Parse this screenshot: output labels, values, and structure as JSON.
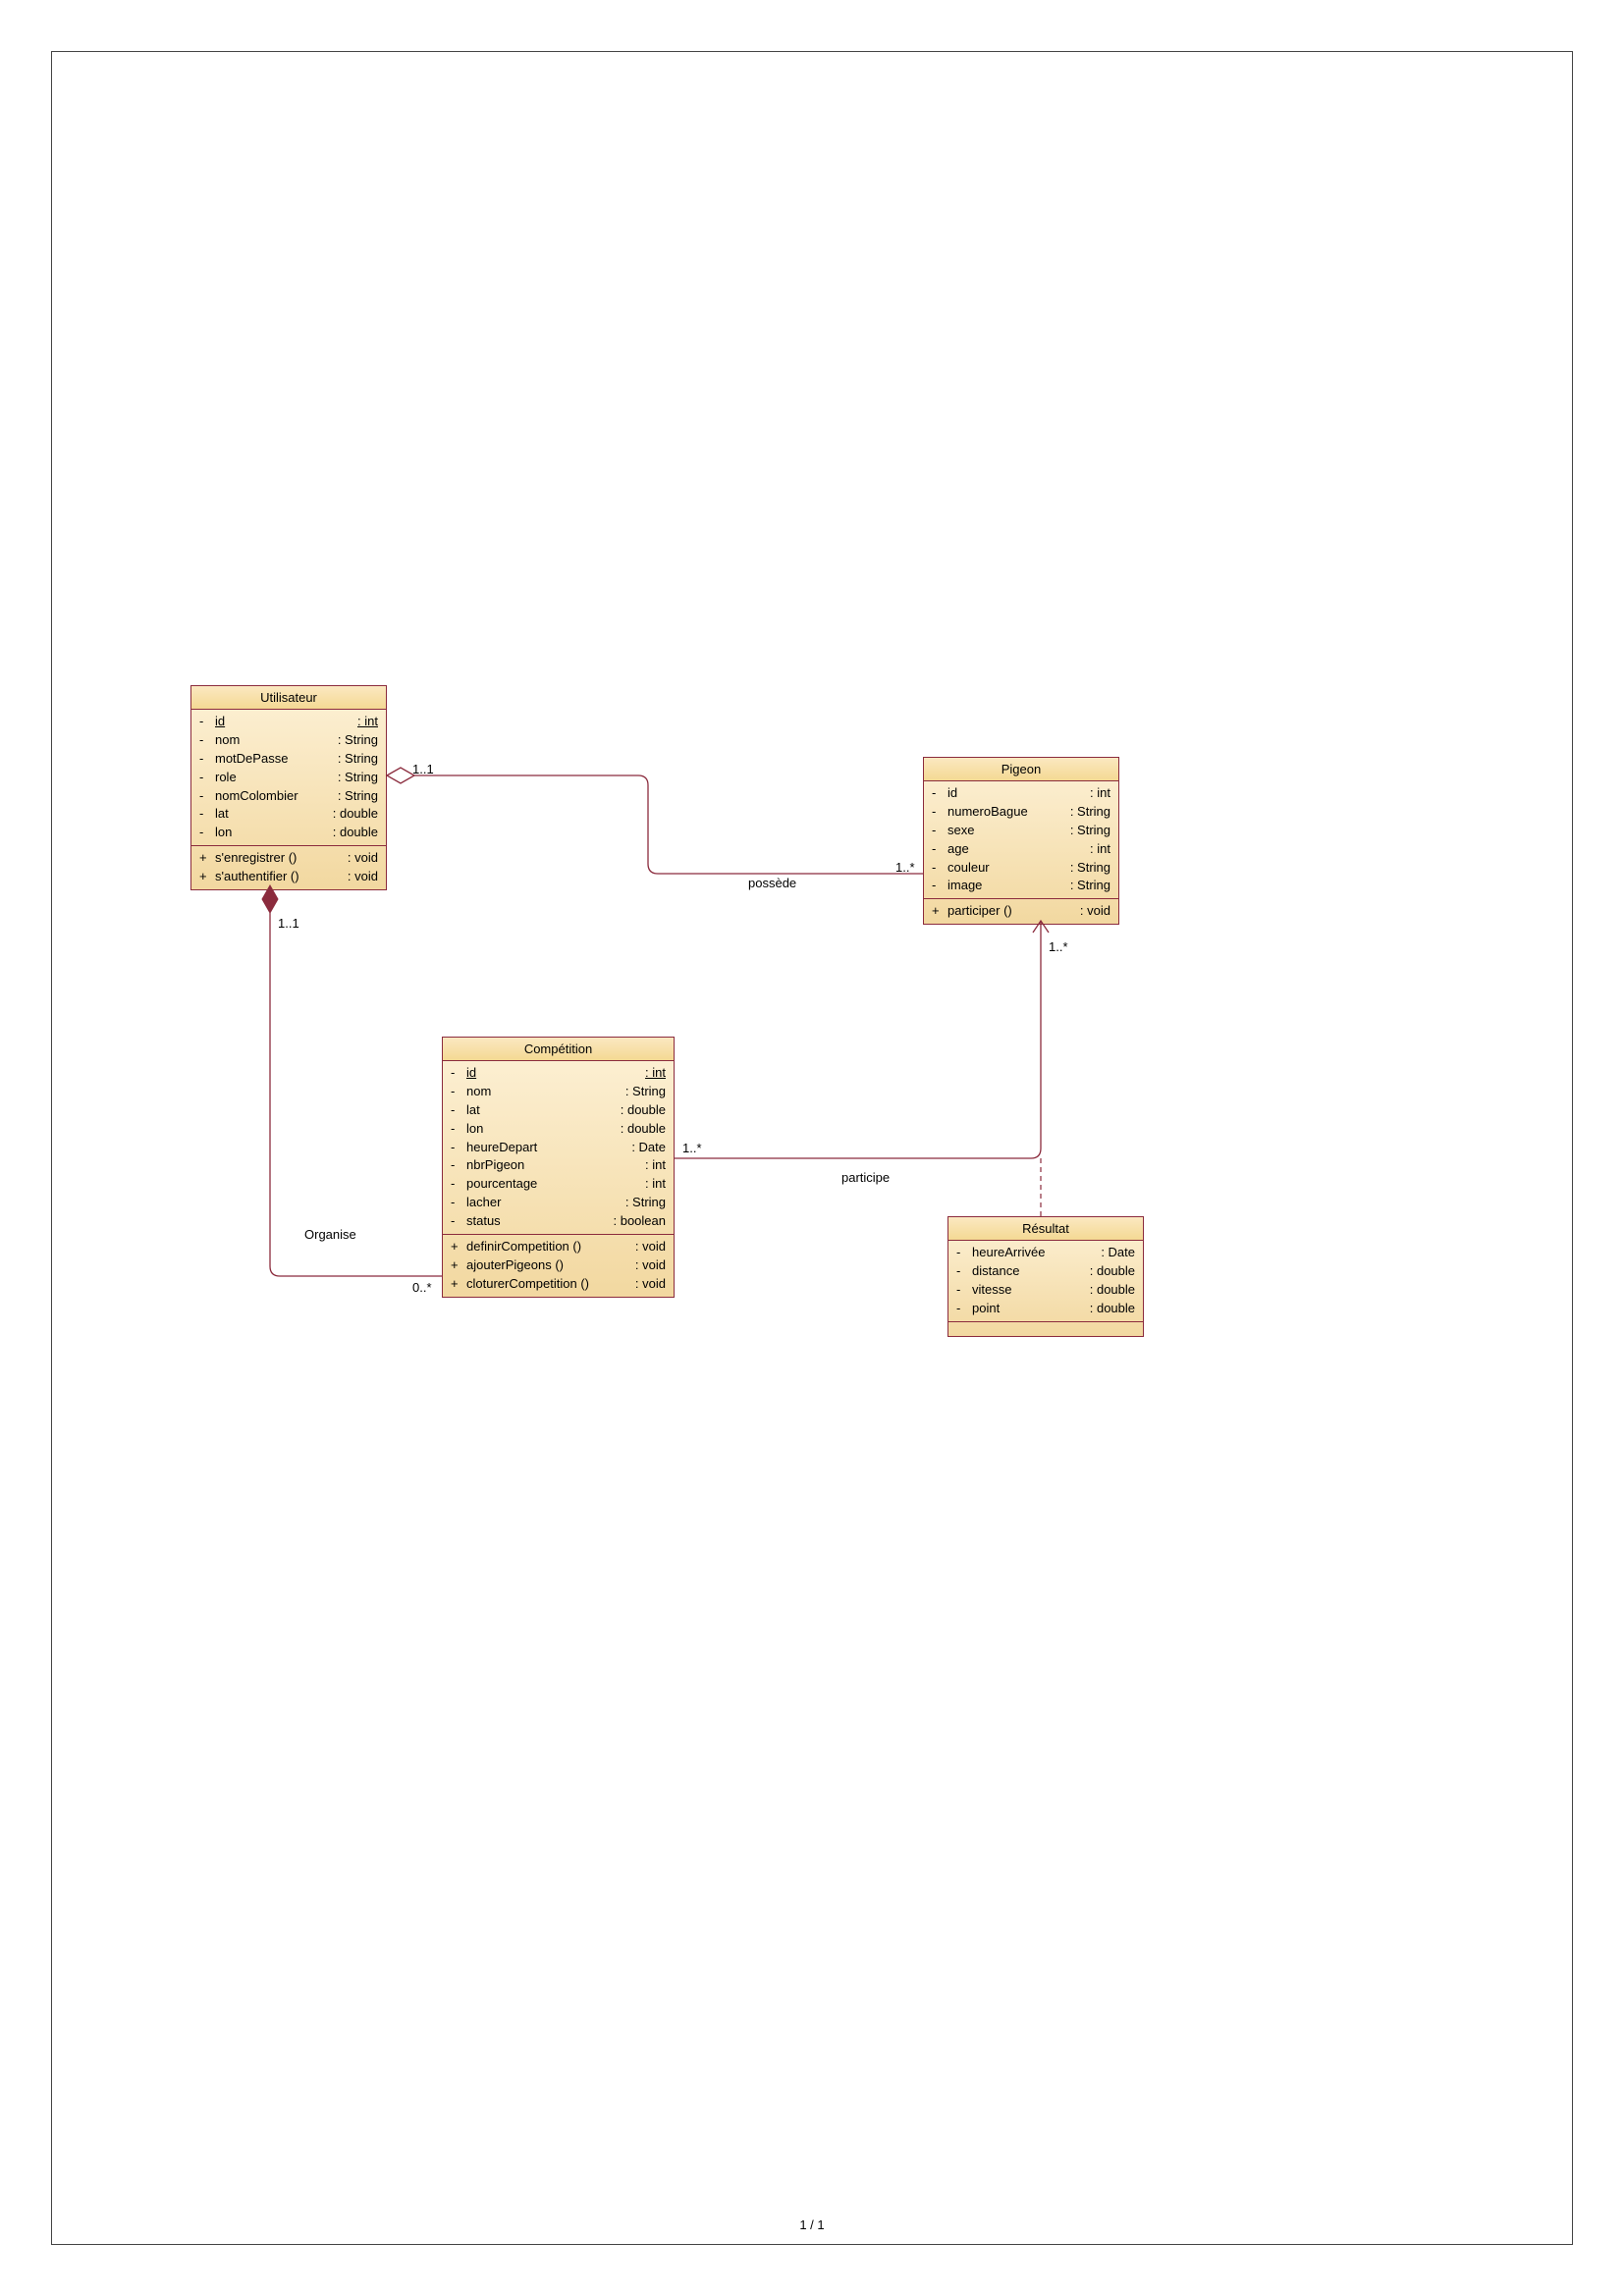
{
  "page_number": "1 / 1",
  "classes": {
    "utilisateur": {
      "title": "Utilisateur",
      "attrs": [
        {
          "vis": "-",
          "name": "id",
          "type": ": int",
          "underline": true
        },
        {
          "vis": "-",
          "name": "nom",
          "type": ": String"
        },
        {
          "vis": "-",
          "name": "motDePasse",
          "type": ": String"
        },
        {
          "vis": "-",
          "name": "role",
          "type": ": String"
        },
        {
          "vis": "-",
          "name": "nomColombier",
          "type": ": String"
        },
        {
          "vis": "-",
          "name": "lat",
          "type": ": double"
        },
        {
          "vis": "-",
          "name": "lon",
          "type": ": double"
        }
      ],
      "ops": [
        {
          "vis": "+",
          "name": "s'enregistrer ()",
          "type": ": void"
        },
        {
          "vis": "+",
          "name": "s'authentifier ()",
          "type": ": void"
        }
      ]
    },
    "pigeon": {
      "title": "Pigeon",
      "attrs": [
        {
          "vis": "-",
          "name": "id",
          "type": ": int"
        },
        {
          "vis": "-",
          "name": "numeroBague",
          "type": ": String"
        },
        {
          "vis": "-",
          "name": "sexe",
          "type": ": String"
        },
        {
          "vis": "-",
          "name": "age",
          "type": ": int"
        },
        {
          "vis": "-",
          "name": "couleur",
          "type": ": String"
        },
        {
          "vis": "-",
          "name": "image",
          "type": ": String"
        }
      ],
      "ops": [
        {
          "vis": "+",
          "name": "participer ()",
          "type": ": void"
        }
      ]
    },
    "competition": {
      "title": "Compétition",
      "attrs": [
        {
          "vis": "-",
          "name": "id",
          "type": ": int",
          "underline": true
        },
        {
          "vis": "-",
          "name": "nom",
          "type": ": String"
        },
        {
          "vis": "-",
          "name": "lat",
          "type": ": double"
        },
        {
          "vis": "-",
          "name": "lon",
          "type": ": double"
        },
        {
          "vis": "-",
          "name": "heureDepart",
          "type": ": Date"
        },
        {
          "vis": "-",
          "name": "nbrPigeon",
          "type": ": int"
        },
        {
          "vis": "-",
          "name": "pourcentage",
          "type": ": int"
        },
        {
          "vis": "-",
          "name": "lacher",
          "type": ": String"
        },
        {
          "vis": "-",
          "name": "status",
          "type": ": boolean"
        }
      ],
      "ops": [
        {
          "vis": "+",
          "name": "definirCompetition ()",
          "type": ": void"
        },
        {
          "vis": "+",
          "name": "ajouterPigeons ()",
          "type": ": void"
        },
        {
          "vis": "+",
          "name": "cloturerCompetition ()",
          "type": ": void"
        }
      ]
    },
    "resultat": {
      "title": "Résultat",
      "attrs": [
        {
          "vis": "-",
          "name": "heureArrivée",
          "type": ": Date"
        },
        {
          "vis": "-",
          "name": "distance",
          "type": ": double"
        },
        {
          "vis": "-",
          "name": "vitesse",
          "type": ": double"
        },
        {
          "vis": "-",
          "name": "point",
          "type": ": double"
        }
      ]
    }
  },
  "relations": {
    "possede": {
      "label": "possède",
      "m_left": "1..1",
      "m_right": "1..*"
    },
    "organise": {
      "label": "Organise",
      "m_top": "1..1",
      "m_bottom": "0..*"
    },
    "participe": {
      "label": "participe",
      "m_left": "1..*",
      "m_right": "1..*"
    }
  }
}
